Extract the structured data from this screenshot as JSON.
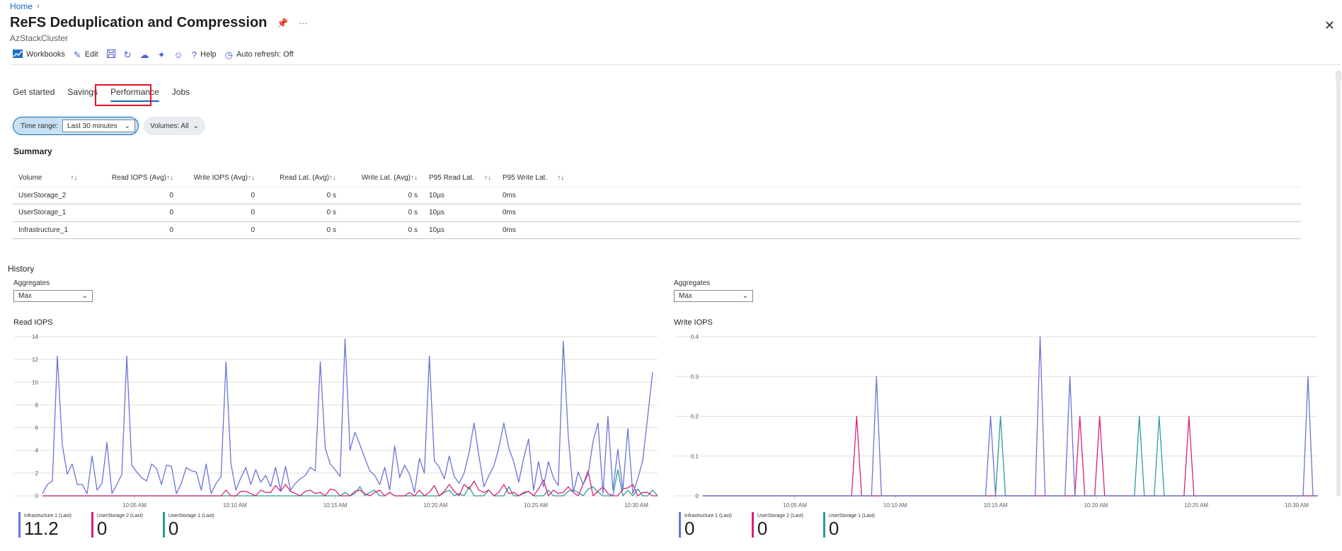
{
  "breadcrumb": {
    "home": "Home"
  },
  "header": {
    "title": "ReFS Deduplication and Compression",
    "subtitle": "AzStackCluster"
  },
  "toolbar": {
    "workbooks": "Workbooks",
    "edit": "Edit",
    "help": "Help",
    "auto_refresh": "Auto refresh: Off"
  },
  "tabs": [
    {
      "label": "Get started"
    },
    {
      "label": "Savings"
    },
    {
      "label": "Performance",
      "active": true
    },
    {
      "label": "Jobs"
    }
  ],
  "filters": {
    "time_range_label": "Time range:",
    "time_range_value": "Last 30 minutes",
    "volumes_label": "Volumes: All"
  },
  "summary": {
    "title": "Summary",
    "columns": [
      "Volume",
      "Read IOPS (Avg)",
      "Write IOPS (Avg)",
      "Read Lat. (Avg)",
      "Write Lat. (Avg)",
      "P95 Read Lat.",
      "P95 Write Lat."
    ],
    "rows": [
      [
        "UserStorage_2",
        "0",
        "0",
        "0 s",
        "0 s",
        "10µs",
        "0ms"
      ],
      [
        "UserStorage_1",
        "0",
        "0",
        "0 s",
        "0 s",
        "10µs",
        "0ms"
      ],
      [
        "Infrastructure_1",
        "0",
        "0",
        "0 s",
        "0 s",
        "10µs",
        "0ms"
      ]
    ]
  },
  "history": {
    "title": "History",
    "aggregates_label": "Aggregates",
    "aggregates_value": "Max"
  },
  "legend": {
    "series": [
      {
        "name": "Infrastructure 1 (Last)",
        "color": "#6b74d6"
      },
      {
        "name": "UserStorage 2 (Last)",
        "color": "#d4237a"
      },
      {
        "name": "UserStorage 1 (Last)",
        "color": "#2e9a9a"
      }
    ]
  },
  "chart_data": [
    {
      "type": "line",
      "title": "Read IOPS",
      "xlabel": "",
      "ylabel": "",
      "ylim": [
        0,
        14
      ],
      "y_ticks": [
        0,
        2,
        4,
        6,
        8,
        10,
        12,
        14
      ],
      "x_ticks": [
        "10:05 AM",
        "10:10 AM",
        "10:15 AM",
        "10:20 AM",
        "10:25 AM",
        "10:30 AM"
      ],
      "grid": true,
      "x_range": [
        0,
        124
      ],
      "series": [
        {
          "name": "Infrastructure 1 (Last)",
          "color": "#6b74d6",
          "last": "11.2",
          "values": [
            0.2,
            1,
            1.3,
            12.3,
            4.5,
            1.9,
            2.8,
            1,
            1,
            0.2,
            3.5,
            0.5,
            1.1,
            4.7,
            0.2,
            1,
            1.9,
            12.3,
            2.7,
            2.1,
            1.6,
            1.3,
            2.8,
            2.4,
            1,
            2.7,
            2.6,
            0.2,
            1.1,
            2.5,
            2.2,
            2.1,
            0.5,
            2.8,
            0.2,
            1.1,
            1.7,
            11.8,
            2.8,
            0.5,
            1.6,
            2.5,
            1,
            2.3,
            1.2,
            1.8,
            0.8,
            2.5,
            0.5,
            2.6,
            0.5,
            1.1,
            1.5,
            1.8,
            2.5,
            2.2,
            11.8,
            4.2,
            2.8,
            2.3,
            1.7,
            13.8,
            4,
            5.6,
            4.5,
            3.3,
            2.2,
            1.8,
            1,
            2.5,
            0.5,
            4.4,
            1.6,
            2.7,
            1.9,
            0.3,
            3.3,
            2,
            12.3,
            3.1,
            2.5,
            1.5,
            3.5,
            1.7,
            1.1,
            2,
            3.8,
            6.4,
            3.5,
            0.8,
            1.8,
            2.6,
            4.2,
            6.4,
            4.2,
            3,
            1.2,
            3.3,
            5,
            0.5,
            3,
            0.8,
            3,
            1.6,
            0.9,
            13.6,
            5.2,
            0.3,
            2.1,
            1,
            1.9,
            4.8,
            6.4,
            0.2,
            7,
            0.5,
            4.1,
            0.5,
            5.9,
            0.2,
            1.5,
            3.1,
            6.9,
            10.9
          ]
        },
        {
          "name": "UserStorage 2 (Last)",
          "color": "#d4237a",
          "last": "0",
          "values": [
            0,
            0,
            0,
            0,
            0,
            0,
            0,
            0,
            0,
            0,
            0,
            0,
            0,
            0,
            0,
            0,
            0,
            0,
            0,
            0,
            0,
            0,
            0,
            0,
            0,
            0,
            0,
            0,
            0,
            0,
            0,
            0,
            0,
            0,
            0,
            0,
            0,
            0.5,
            0,
            0,
            0.4,
            0.4,
            0.2,
            0,
            0.5,
            0.3,
            0.3,
            0.9,
            0.4,
            1,
            0.4,
            0.2,
            0,
            0.4,
            0.5,
            0.2,
            0.3,
            0,
            0.6,
            0.5,
            0,
            0,
            0,
            0.4,
            0.5,
            0.2,
            0,
            0.3,
            0.5,
            0,
            0.3,
            0,
            0,
            0,
            0.3,
            0,
            0.5,
            0,
            0.3,
            0.9,
            0,
            0.4,
            1,
            0.4,
            0,
            1,
            0.6,
            1.3,
            0.5,
            0.3,
            0.5,
            0,
            0.3,
            1,
            0.2,
            0.3,
            0,
            0.3,
            0.4,
            0,
            0.6,
            1.4,
            0,
            0.5,
            0.2,
            0.3,
            0.8,
            0.3,
            0,
            1,
            2.2,
            0,
            0.4,
            0.8,
            0.2,
            0,
            0,
            0.6,
            0.7,
            1,
            0,
            0.3,
            0.3,
            0,
            0
          ]
        },
        {
          "name": "UserStorage 1 (Last)",
          "color": "#2e9a9a",
          "last": "0",
          "values": [
            0,
            0,
            0,
            0,
            0,
            0,
            0,
            0,
            0,
            0,
            0,
            0,
            0,
            0,
            0,
            0,
            0,
            0,
            0,
            0,
            0,
            0,
            0,
            0,
            0,
            0,
            0,
            0,
            0,
            0,
            0,
            0,
            0,
            0,
            0,
            0,
            0,
            0,
            0,
            0,
            0,
            0,
            0,
            0,
            0,
            0,
            0,
            0,
            0,
            0,
            0,
            0,
            0,
            0,
            0,
            0,
            0,
            0,
            0,
            0,
            0,
            0.3,
            0,
            0.2,
            0.8,
            0,
            0.3,
            0.5,
            0,
            0,
            0.3,
            0,
            0,
            0,
            0,
            0,
            0,
            0,
            0,
            0,
            0,
            0.3,
            0.5,
            0,
            0.2,
            0,
            0.8,
            0,
            0,
            0,
            0.5,
            0,
            0,
            0,
            0.8,
            0,
            0,
            0.2,
            0.4,
            0,
            0,
            0,
            0.5,
            0,
            0,
            0,
            0.4,
            0.5,
            0.3,
            0,
            0.6,
            0.8,
            0.3,
            0,
            0,
            0,
            2.3,
            0,
            0.5,
            0,
            0.6,
            0,
            0,
            0.5,
            0
          ]
        }
      ]
    },
    {
      "type": "line",
      "title": "Write IOPS",
      "xlabel": "",
      "ylabel": "",
      "ylim": [
        0,
        0.4
      ],
      "y_ticks": [
        0,
        0.1,
        0.2,
        0.3,
        0.4
      ],
      "x_ticks": [
        "10:05 AM",
        "10:10 AM",
        "10:15 AM",
        "10:20 AM",
        "10:25 AM",
        "10:30 AM"
      ],
      "grid": true,
      "x_range": [
        0,
        124
      ],
      "series": [
        {
          "name": "Infrastructure 1 (Last)",
          "color": "#6b74d6",
          "last": "0",
          "peaks": [
            [
              35,
              0.3
            ],
            [
              58,
              0.2
            ],
            [
              68,
              0.4
            ],
            [
              74,
              0.3
            ],
            [
              122,
              0.3
            ]
          ]
        },
        {
          "name": "UserStorage 2 (Last)",
          "color": "#d4237a",
          "last": "0",
          "peaks": [
            [
              31,
              0.2
            ],
            [
              76,
              0.2
            ],
            [
              80,
              0.2
            ],
            [
              98,
              0.2
            ]
          ]
        },
        {
          "name": "UserStorage 1 (Last)",
          "color": "#2e9a9a",
          "last": "0",
          "peaks": [
            [
              60,
              0.2
            ],
            [
              88,
              0.2
            ],
            [
              92,
              0.2
            ]
          ]
        }
      ]
    }
  ]
}
